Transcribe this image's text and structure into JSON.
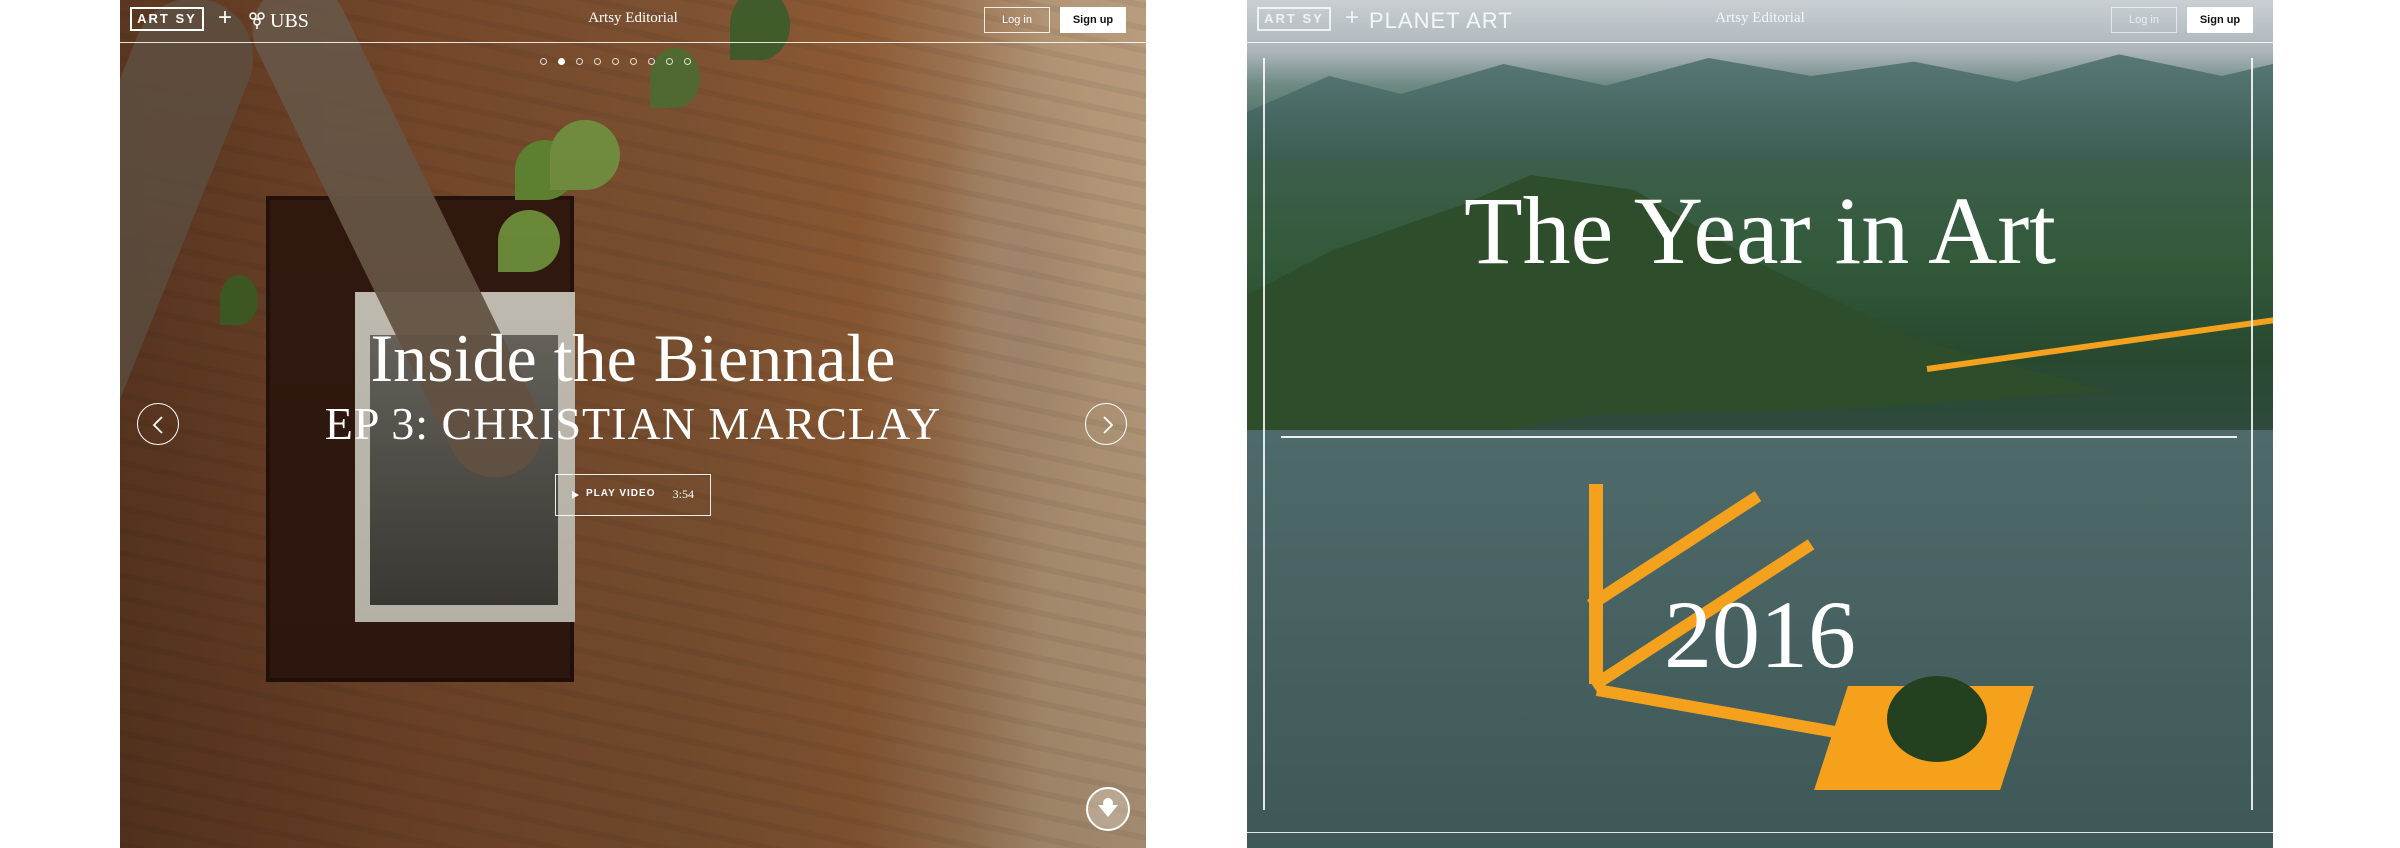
{
  "left": {
    "logo": "ART SY",
    "partner": "UBS",
    "nav_title": "Artsy Editorial",
    "login": "Log in",
    "signup": "Sign up",
    "slides": {
      "count": 9,
      "active": 2
    },
    "title": "Inside the Biennale",
    "subtitle": "EP 3: CHRISTIAN MARCLAY",
    "play_label": "PLAY VIDEO",
    "duration": "3:54"
  },
  "right": {
    "logo": "ART SY",
    "partner": "PLANET ART",
    "nav_title": "Artsy Editorial",
    "login": "Log in",
    "signup": "Sign up",
    "title": "The Year in Art",
    "year": "2016"
  }
}
